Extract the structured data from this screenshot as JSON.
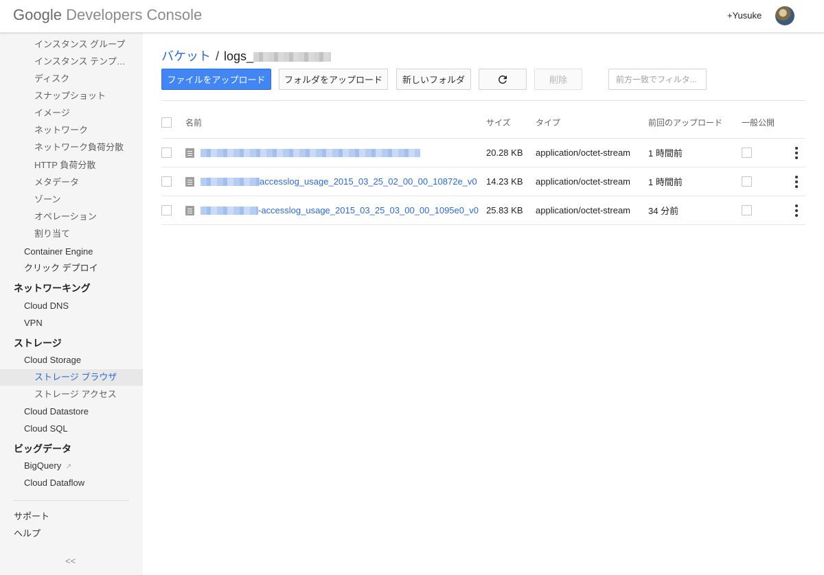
{
  "header": {
    "brand": "Google",
    "product": "Developers Console",
    "user_name": "+Yusuke"
  },
  "sidebar": {
    "items": [
      {
        "label": "インスタンス グループ",
        "level": 2
      },
      {
        "label": "インスタンス テンプ…",
        "level": 2
      },
      {
        "label": "ディスク",
        "level": 2
      },
      {
        "label": "スナップショット",
        "level": 2
      },
      {
        "label": "イメージ",
        "level": 2
      },
      {
        "label": "ネットワーク",
        "level": 2
      },
      {
        "label": "ネットワーク負荷分散",
        "level": 2
      },
      {
        "label": "HTTP 負荷分散",
        "level": 2
      },
      {
        "label": "メタデータ",
        "level": 2
      },
      {
        "label": "ゾーン",
        "level": 2
      },
      {
        "label": "オペレーション",
        "level": 2
      },
      {
        "label": "割り当て",
        "level": 2
      },
      {
        "label": "Container Engine",
        "level": 1
      },
      {
        "label": "クリック デプロイ",
        "level": 1
      },
      {
        "label": "ネットワーキング",
        "level": 0
      },
      {
        "label": "Cloud DNS",
        "level": 1
      },
      {
        "label": "VPN",
        "level": 1
      },
      {
        "label": "ストレージ",
        "level": 0
      },
      {
        "label": "Cloud Storage",
        "level": 1
      },
      {
        "label": "ストレージ ブラウザ",
        "level": 2,
        "active": true
      },
      {
        "label": "ストレージ アクセス",
        "level": 2
      },
      {
        "label": "Cloud Datastore",
        "level": 1
      },
      {
        "label": "Cloud SQL",
        "level": 1
      },
      {
        "label": "ビッグデータ",
        "level": 0
      },
      {
        "label": "BigQuery",
        "level": 1,
        "external": true
      },
      {
        "label": "Cloud Dataflow",
        "level": 1
      }
    ],
    "footer": [
      {
        "label": "サポート"
      },
      {
        "label": "ヘルプ"
      }
    ],
    "collapse_label": "<<"
  },
  "breadcrumb": {
    "parent": "バケット",
    "separator": "/",
    "current_prefix": "logs_"
  },
  "toolbar": {
    "upload_files": "ファイルをアップロード",
    "upload_folder": "フォルダをアップロード",
    "new_folder": "新しいフォルダ",
    "refresh_icon": "refresh-icon",
    "delete": "削除",
    "filter_placeholder": "前方一致でフィルタ..."
  },
  "table": {
    "columns": {
      "name": "名前",
      "size": "サイズ",
      "type": "タイプ",
      "last_upload": "前回のアップロード",
      "public": "一般公開"
    },
    "rows": [
      {
        "name_suffix": "",
        "size": "20.28 KB",
        "type": "application/octet-stream",
        "last_upload": "1 時間前"
      },
      {
        "name_suffix": "accesslog_usage_2015_03_25_02_00_00_10872e_v0",
        "size": "14.23 KB",
        "type": "application/octet-stream",
        "last_upload": "1 時間前"
      },
      {
        "name_suffix": "-accesslog_usage_2015_03_25_03_00_00_1095e0_v0",
        "size": "25.83 KB",
        "type": "application/octet-stream",
        "last_upload": "34 分前"
      }
    ]
  },
  "colors": {
    "accent": "#4285f4",
    "link": "#2a6ad8",
    "sidebar_bg": "#f5f5f5"
  }
}
